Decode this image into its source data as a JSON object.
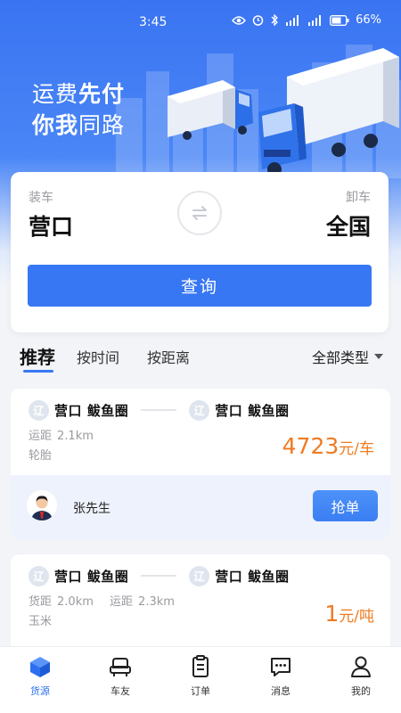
{
  "status_bar": {
    "time": "3:45",
    "battery": "66%"
  },
  "hero": {
    "slogan_line1_a": "运费",
    "slogan_line1_b": "先付",
    "slogan_line2_a": "你我",
    "slogan_line2_b": "同路"
  },
  "search": {
    "from_label": "装车",
    "from_city": "营口",
    "to_label": "卸车",
    "to_city": "全国",
    "swap_icon": "swap-arrows-icon",
    "query_label": "查询"
  },
  "tabs": {
    "items": [
      "推荐",
      "按时间",
      "按距离"
    ],
    "active": 0,
    "type_filter": "全部类型"
  },
  "orders": [
    {
      "from_badge": "辽",
      "from": "营口 鲅鱼圈",
      "to_badge": "辽",
      "to": "营口 鲅鱼圈",
      "meta_line1": [
        {
          "label": "运距",
          "value": "2.1km"
        }
      ],
      "meta_line2": "轮胎",
      "price": "4723",
      "price_unit": "元/车",
      "contact": "张先生",
      "action": "抢单"
    },
    {
      "from_badge": "辽",
      "from": "营口 鲅鱼圈",
      "to_badge": "辽",
      "to": "营口 鲅鱼圈",
      "meta_line1": [
        {
          "label": "货距",
          "value": "2.0km"
        },
        {
          "label": "运距",
          "value": "2.3km"
        }
      ],
      "meta_line2": "玉米",
      "price": "1",
      "price_unit": "元/吨"
    }
  ],
  "bottom_nav": [
    {
      "label": "货源",
      "icon": "cube-icon",
      "active": true
    },
    {
      "label": "车友",
      "icon": "car-icon",
      "active": false
    },
    {
      "label": "订单",
      "icon": "clipboard-icon",
      "active": false
    },
    {
      "label": "消息",
      "icon": "chat-icon",
      "active": false
    },
    {
      "label": "我的",
      "icon": "person-icon",
      "active": false
    }
  ],
  "colors": {
    "primary": "#3777f3",
    "price": "#ef7b22",
    "nav_active": "#2c6ff0"
  }
}
